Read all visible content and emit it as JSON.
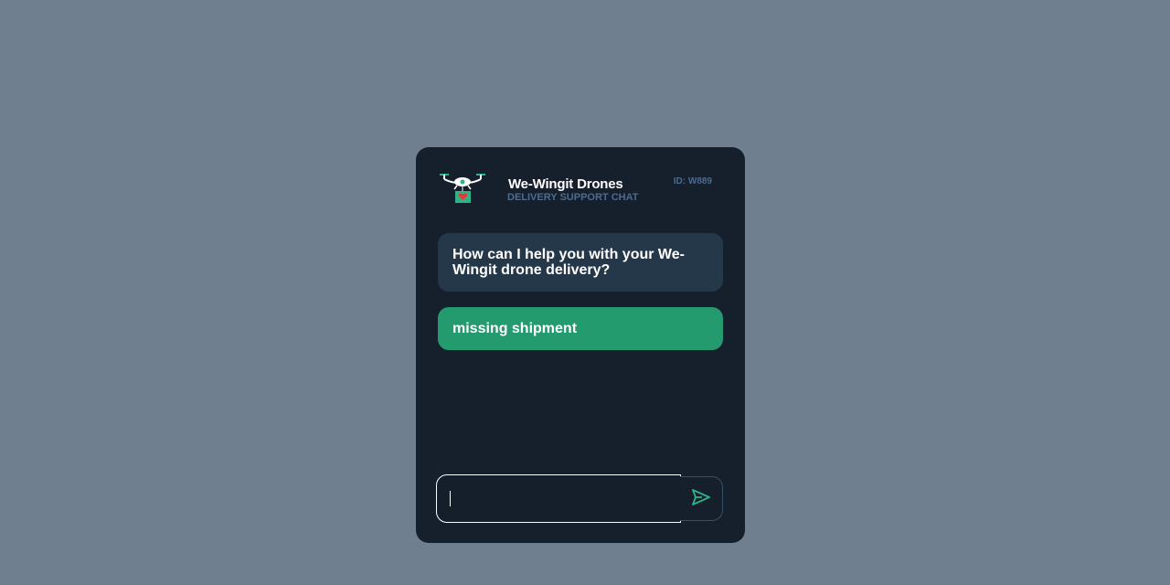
{
  "header": {
    "title": "We-Wingit Drones",
    "subtitle": "DELIVERY SUPPORT CHAT",
    "session_id": "ID: W889",
    "logo_icon": "drone-with-heart-package-icon"
  },
  "messages": [
    {
      "sender": "bot",
      "text": "How can I help you with your We-Wingit drone delivery?"
    },
    {
      "sender": "user",
      "text": "missing shipment"
    }
  ],
  "composer": {
    "value": "",
    "placeholder": "",
    "send_icon": "paper-plane-send-icon"
  },
  "colors": {
    "page_background": "#6f7f8f",
    "panel_background": "#161f2c",
    "bot_bubble": "#253849",
    "user_bubble": "#249a6f",
    "accent": "#2bb487",
    "muted_text": "#4d6b8c"
  }
}
